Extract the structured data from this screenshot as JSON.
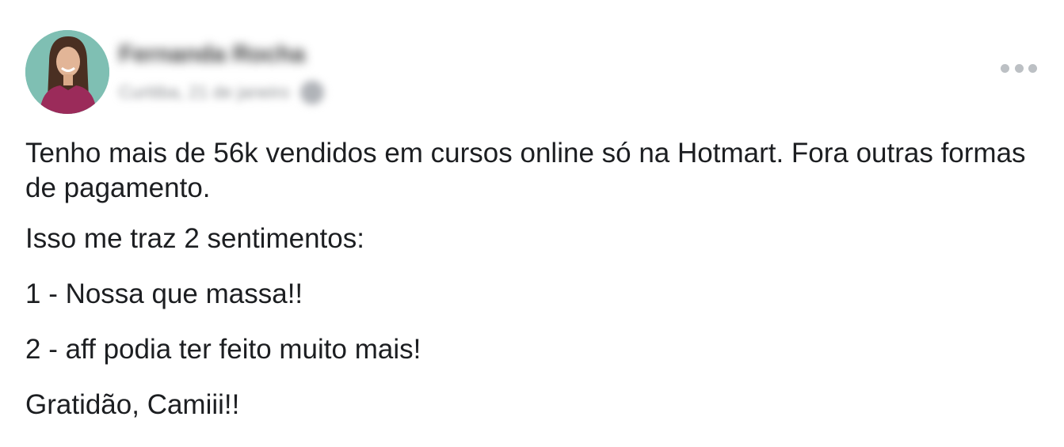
{
  "post": {
    "author": {
      "name": "Fernanda Rocha",
      "meta": "Curitiba, 21 de janeiro",
      "avatar_icon": "profile-photo",
      "privacy_icon": "globe-icon"
    },
    "menu_icon": "more-options-icon",
    "paragraphs": [
      "Tenho mais de 56k vendidos em cursos online só na Hotmart. Fora outras formas de pagamento.",
      "Isso me traz 2 sentimentos:",
      "1 - Nossa que massa!!",
      "2 - aff podia ter feito muito mais!",
      "Gratidão, Camiii!!"
    ]
  },
  "colors": {
    "text": "#1c1e21",
    "muted": "#8a8d91",
    "avatar_bg": "#7fbfb3",
    "dots": "#bcc0c4"
  }
}
